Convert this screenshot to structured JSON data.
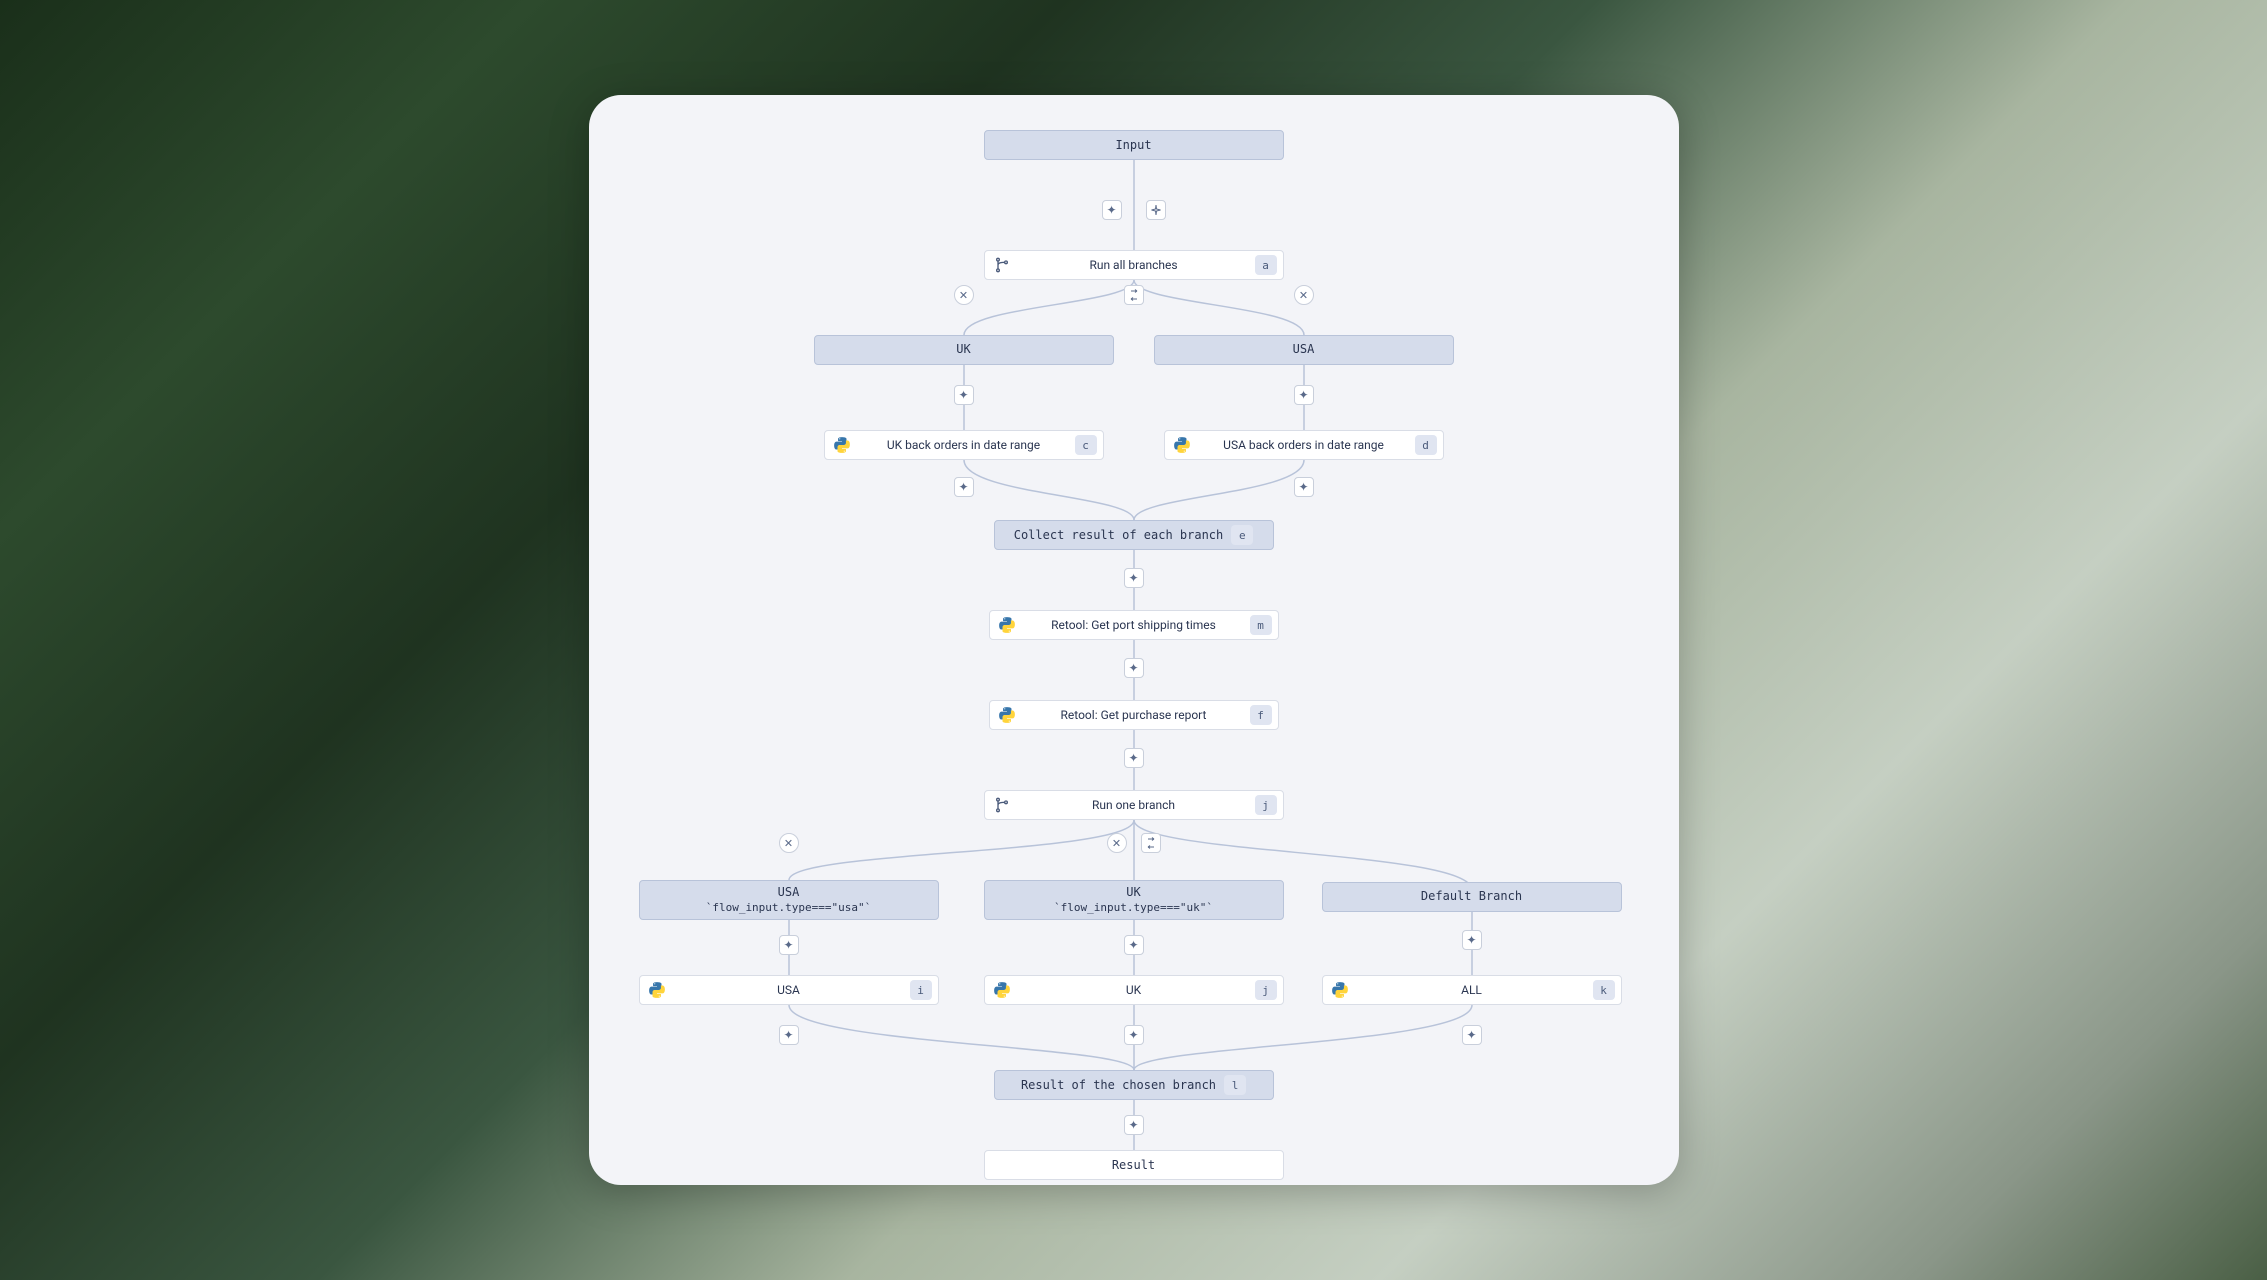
{
  "nodes": {
    "input": {
      "label": "Input"
    },
    "run_all": {
      "label": "Run all branches",
      "key": "a"
    },
    "uk_branch": {
      "label": "UK"
    },
    "usa_branch": {
      "label": "USA"
    },
    "uk_orders": {
      "label": "UK back orders in date range",
      "key": "c"
    },
    "usa_orders": {
      "label": "USA back orders in date range",
      "key": "d"
    },
    "collect": {
      "label": "Collect result of each branch",
      "key": "e"
    },
    "shipping": {
      "label": "Retool: Get port shipping times",
      "key": "m"
    },
    "purchase": {
      "label": "Retool: Get purchase report",
      "key": "f"
    },
    "run_one": {
      "label": "Run one branch",
      "key": "j"
    },
    "b_usa": {
      "title": "USA",
      "expr": "`flow_input.type===\"usa\"`"
    },
    "b_uk": {
      "title": "UK",
      "expr": "`flow_input.type===\"uk\"`"
    },
    "b_default": {
      "title": "Default Branch"
    },
    "usa_step": {
      "label": "USA",
      "key": "i"
    },
    "uk_step": {
      "label": "UK",
      "key": "j"
    },
    "all_step": {
      "label": "ALL",
      "key": "k"
    },
    "chosen": {
      "label": "Result of the chosen branch",
      "key": "l"
    },
    "result": {
      "label": "Result"
    }
  },
  "glyphs": {
    "plus": "✦",
    "add_branch": "⇄",
    "close": "✕"
  }
}
